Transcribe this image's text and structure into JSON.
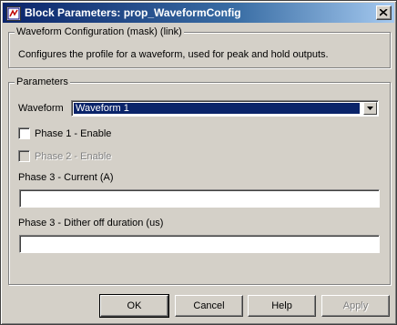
{
  "window": {
    "title": "Block Parameters: prop_WaveformConfig",
    "icon": "simulink-block-icon"
  },
  "mask_group": {
    "legend": "Waveform Configuration (mask) (link)",
    "description": "Configures the profile for a waveform, used for peak and hold outputs."
  },
  "parameters_group": {
    "legend": "Parameters",
    "waveform": {
      "label": "Waveform",
      "selected": "Waveform 1"
    },
    "phase1": {
      "label": "Phase 1 -  Enable",
      "checked": false,
      "enabled": true
    },
    "phase2": {
      "label": "Phase 2 - Enable",
      "checked": false,
      "enabled": false
    },
    "phase3_current": {
      "label": "Phase 3 - Current (A)",
      "value": ""
    },
    "phase3_dither": {
      "label": "Phase 3 - Dither off duration (us)",
      "value": ""
    }
  },
  "buttons": {
    "ok": "OK",
    "cancel": "Cancel",
    "help": "Help",
    "apply": "Apply"
  },
  "colors": {
    "title_bar": "#0a246a",
    "dialog_face": "#d4d0c8",
    "selection": "#0a246a"
  }
}
